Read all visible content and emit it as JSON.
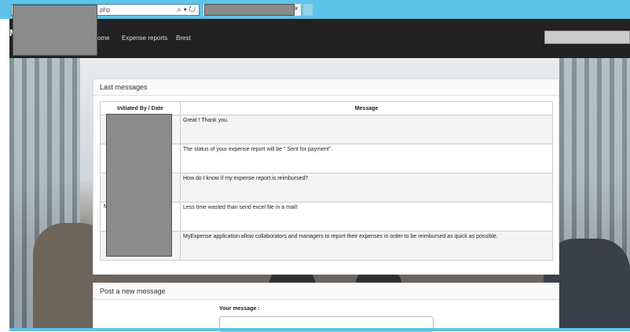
{
  "browser": {
    "address_text": ".php",
    "address_icons": "⌕ ▾ ↻",
    "tab_close": "×"
  },
  "navbar": {
    "brand_letter": "M",
    "items": [
      "ome",
      "Expense reports",
      "Brest"
    ]
  },
  "messages_panel": {
    "title": "Last messages",
    "columns": [
      "Initiated By / Date",
      "Message"
    ],
    "rows": [
      {
        "message": "Great ! Thank you."
      },
      {
        "message": "The status of your expense report will be \" Sent for payment\"."
      },
      {
        "message": "How do I know if my expense report is reimbursed?"
      },
      {
        "message": "Less time wasted than send excel file in a mail!"
      },
      {
        "message": "MyExpense application allow collaborators and managers to report their expenses in order to be reimbursed as quick as possible."
      }
    ],
    "partial_letter": "M"
  },
  "post_panel": {
    "title": "Post a new message",
    "label": "Your message :"
  }
}
